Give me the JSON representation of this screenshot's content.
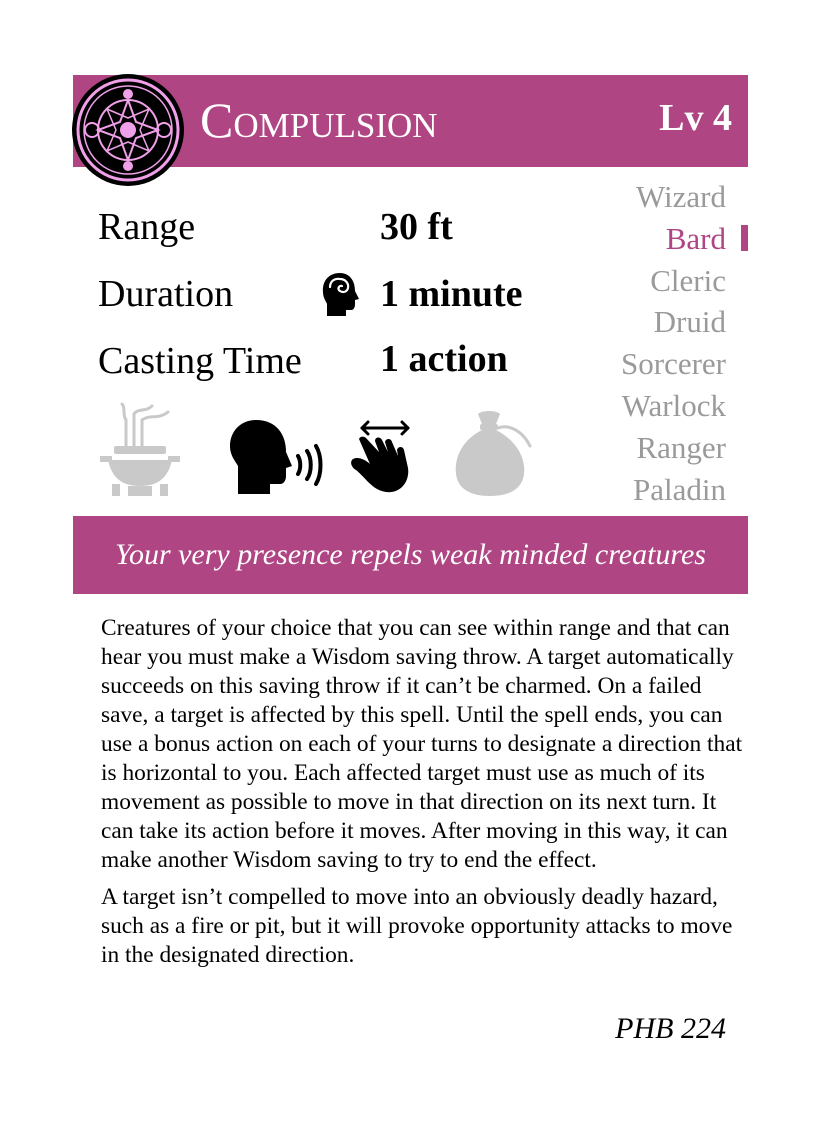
{
  "spell": {
    "name": "Compulsion",
    "level": "Lv 4",
    "flavor": "Your very presence repels weak minded creatures",
    "source": "PHB 224"
  },
  "stats": {
    "range_label": "Range",
    "range_value": "30 ft",
    "duration_label": "Duration",
    "duration_value": "1 minute",
    "casting_time_label": "Casting Time",
    "casting_time_value": "1 action"
  },
  "icons": {
    "emblem": "enchantment-school-emblem-icon",
    "concentration": "concentration-head-icon",
    "ritual": "ritual-incense-icon",
    "verbal": "verbal-speaking-icon",
    "somatic": "somatic-hand-icon",
    "material": "material-pouch-icon"
  },
  "components": {
    "ritual_active": false,
    "verbal_active": true,
    "somatic_active": true,
    "material_active": false
  },
  "classes": [
    {
      "name": "Wizard",
      "active": false
    },
    {
      "name": "Bard",
      "active": true
    },
    {
      "name": "Cleric",
      "active": false
    },
    {
      "name": "Druid",
      "active": false
    },
    {
      "name": "Sorcerer",
      "active": false
    },
    {
      "name": "Warlock",
      "active": false
    },
    {
      "name": "Ranger",
      "active": false
    },
    {
      "name": "Paladin",
      "active": false
    }
  ],
  "description": [
    "Creatures of your choice that you can see within range and that can hear you must make a Wisdom saving throw. A target automatically succeeds on this saving throw if it can’t be charmed. On a failed save, a target is affected by this spell. Until the spell ends, you can use a bonus action on each of your turns to designate a direction that is horizontal to you. Each affected target must use as much of its movement as possible to move in that direction on its next turn. It can take its action before it moves. After moving in this way, it can make another Wisdom saving to try to end the effect.",
    "A target isn’t compelled to move into an obviously deadly hazard, such as a fire or pit, but it will provoke opportunity attacks to move in the designated direction."
  ],
  "colors": {
    "accent": "#b04583",
    "inactive": "#9a9a9a",
    "emblem_glow": "#f0a0e8"
  }
}
